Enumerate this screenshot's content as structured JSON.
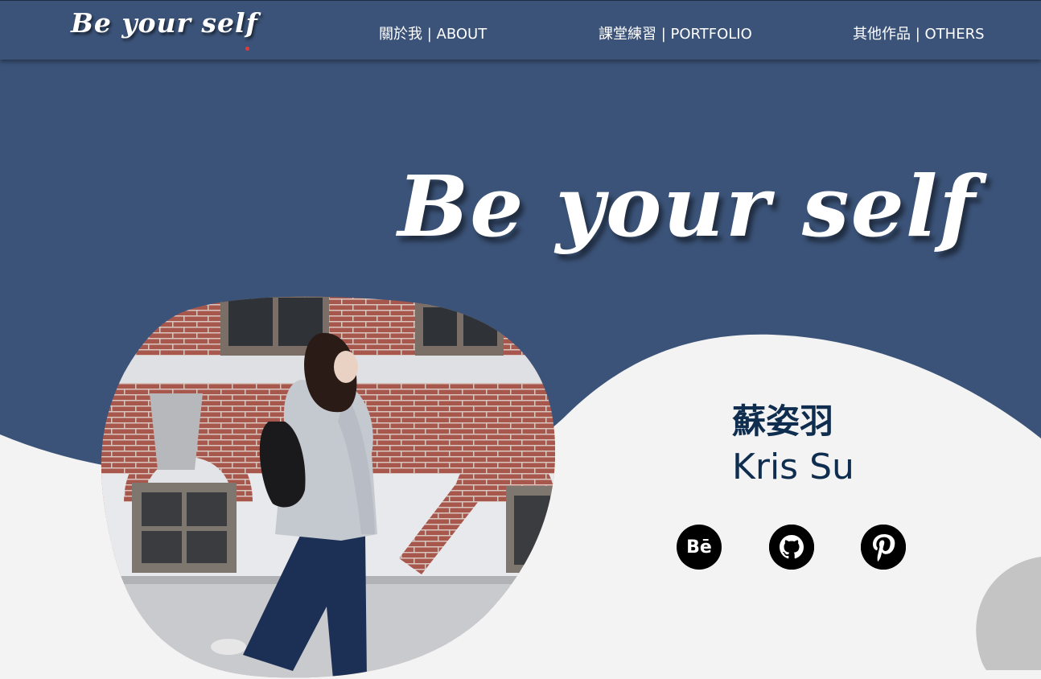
{
  "nav": {
    "logo": "Be your self",
    "items": [
      {
        "label": "關於我 | ABOUT"
      },
      {
        "label": "課堂練習 | PORTFOLIO"
      },
      {
        "label": "其他作品 | OTHERS"
      }
    ]
  },
  "hero": {
    "title": "Be your self"
  },
  "profile": {
    "name_zh": "蘇姿羽",
    "name_en": "Kris Su"
  },
  "social": {
    "behance": {
      "label": "Bē",
      "icon": "behance-icon"
    },
    "github": {
      "icon": "github-icon"
    },
    "pinterest": {
      "icon": "pinterest-icon"
    }
  },
  "colors": {
    "primary": "#3b5378",
    "background": "#f3f3f3",
    "name_text": "#0f2d4e",
    "accent_dot": "#e53935",
    "decor_gray": "#c4c4c4"
  }
}
